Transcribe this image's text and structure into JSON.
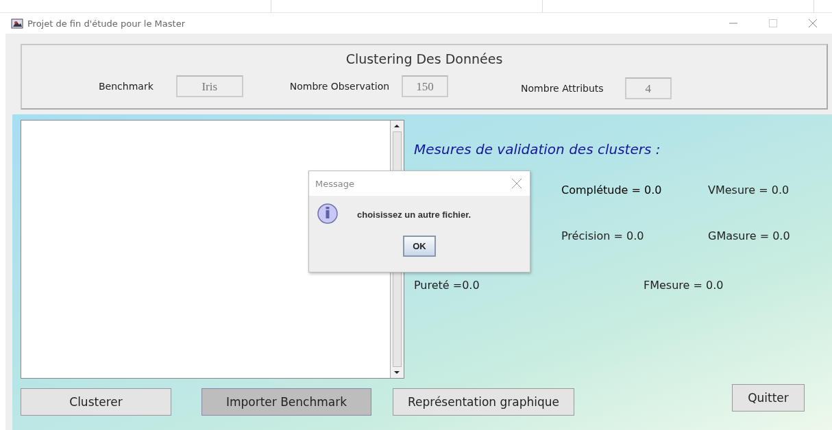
{
  "window": {
    "title": "Projet de fin d'étude pour le Master"
  },
  "header": {
    "title": "Clustering Des Données",
    "fields": [
      {
        "label": "Benchmark",
        "value": "Iris"
      },
      {
        "label": "Nombre Observation",
        "value": "150"
      },
      {
        "label": "Nombre Attributs",
        "value": "4"
      }
    ]
  },
  "measures": {
    "title": "Mesures de validation des clusters :",
    "rows": [
      [
        {
          "text": "Complétude = 0.0"
        },
        {
          "text": "VMesure = 0.0"
        }
      ],
      [
        {
          "text": "Précision = 0.0"
        },
        {
          "text": "GMasure = 0.0"
        }
      ],
      [
        {
          "text": "Pureté =0.0"
        },
        {
          "text": "FMesure = 0.0"
        }
      ]
    ]
  },
  "buttons": [
    {
      "label": "Clusterer",
      "pressed": false
    },
    {
      "label": "Importer Benchmark",
      "pressed": true
    },
    {
      "label": "Représentation graphique",
      "pressed": false
    }
  ],
  "quit_button": {
    "label": "Quitter"
  },
  "dialog": {
    "title": "Message",
    "message": "choisissez un autre fichier.",
    "button": "OK"
  }
}
